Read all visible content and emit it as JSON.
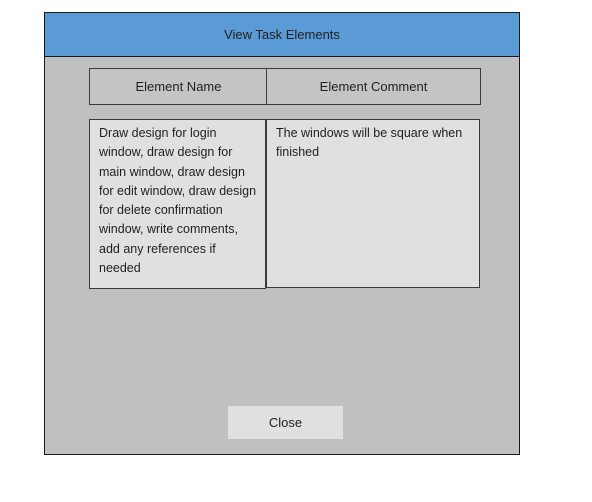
{
  "window": {
    "title": "View Task Elements"
  },
  "table": {
    "columns": [
      "Element Name",
      "Element Comment"
    ],
    "rows": [
      {
        "name": "Draw design for login window, draw design for main window, draw design for edit window, draw design for delete confirmation window, write comments, add any references if needed",
        "comment": "The windows will be square when finished"
      }
    ]
  },
  "actions": {
    "close_label": "Close"
  },
  "colors": {
    "titlebar": "#5b9bd5",
    "window_background": "#c0c0c0",
    "cell_background": "#e0e0e0"
  }
}
